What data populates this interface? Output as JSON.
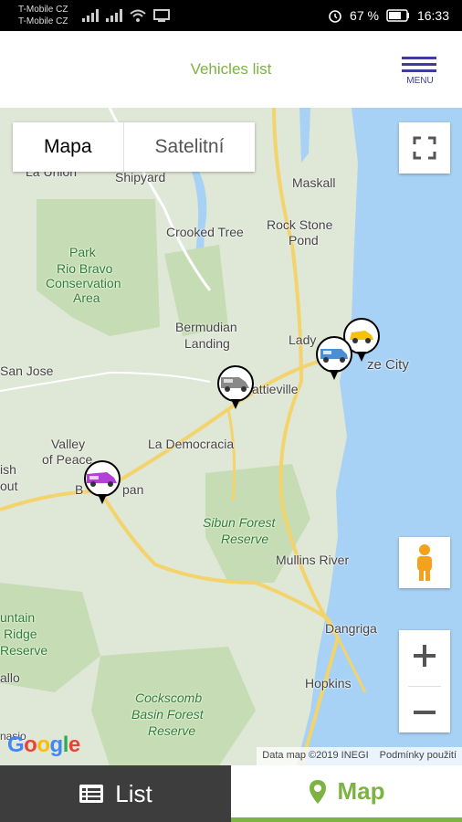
{
  "status_bar": {
    "carrier_1": "T-Mobile CZ",
    "carrier_2": "T-Mobile CZ",
    "battery": "67 %",
    "time": "16:33"
  },
  "header": {
    "title": "Vehicles list",
    "menu_label": "MENU"
  },
  "map": {
    "type_map": "Mapa",
    "type_satellite": "Satelitní",
    "attribution": "Data map ©2019 INEGI",
    "terms": "Podmínky použití",
    "logo": "Google",
    "places": {
      "la_union": "La Union",
      "shipyard": "Shipyard",
      "maskall": "Maskall",
      "crooked_tree": "Crooked Tree",
      "rock_stone_pond_1": "Rock Stone",
      "rock_stone_pond_2": "Pond",
      "park": "Park",
      "rio_bravo_1": "Rio Bravo",
      "rio_bravo_2": "Conservation",
      "rio_bravo_3": "Area",
      "bermudian_1": "Bermudian",
      "bermudian_2": "Landing",
      "ladyville": "Lady",
      "belize_city": "ze City",
      "san_jose": "San Jose",
      "hattieville": "attieville",
      "valley_1": "Valley",
      "valley_2": "of Peace",
      "la_democracia": "La Democracia",
      "ish": "ish",
      "out": "out",
      "belmopan": "B",
      "belmopan_2": "pan",
      "sibun_1": "Sibun Forest",
      "sibun_2": "Reserve",
      "mullins": "Mullins River",
      "mountain_1": "untain",
      "mountain_2": "Ridge",
      "mountain_3": "Reserve",
      "dangriga": "Dangriga",
      "allo": "allo",
      "hopkins": "Hopkins",
      "cockscomb_1": "Cockscomb",
      "cockscomb_2": "Basin Forest",
      "cockscomb_3": "Reserve",
      "nasio": "nasio"
    },
    "colors": {
      "water": "#a8d2f5",
      "land": "#dfe7d6",
      "reserve": "#c5dcb4",
      "road": "#f3d36b"
    }
  },
  "tabs": {
    "list_label": "List",
    "map_label": "Map",
    "active_color": "#7cb342"
  }
}
